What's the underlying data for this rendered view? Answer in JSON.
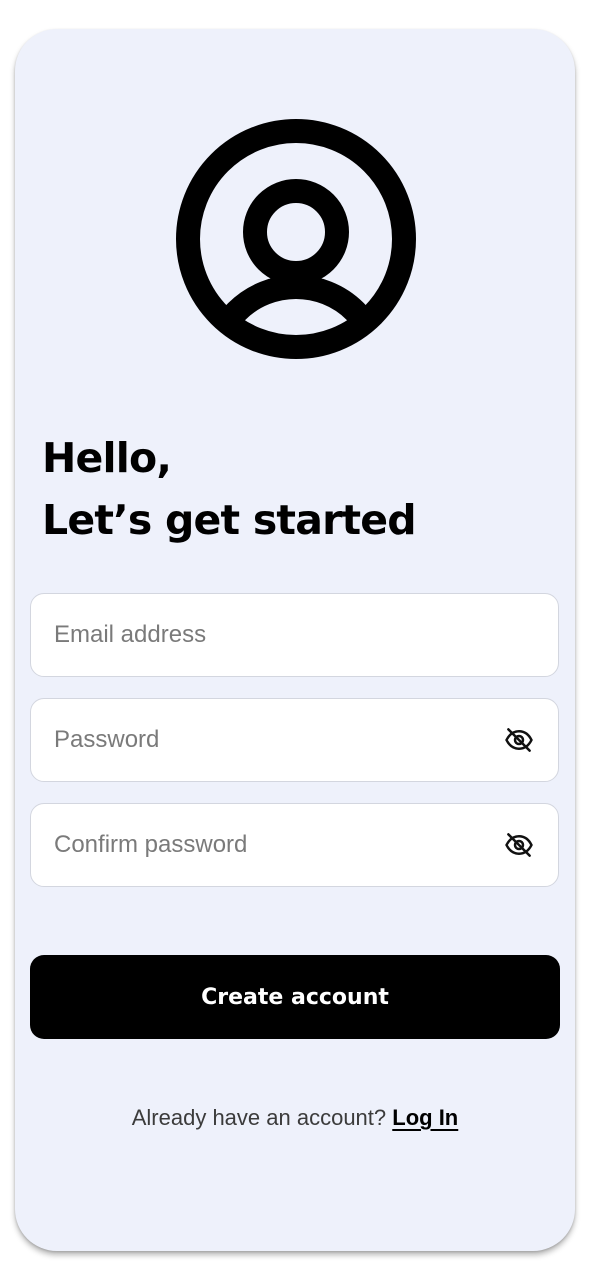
{
  "header": {
    "avatar_icon": "user-circle-icon",
    "greeting_line1": "Hello,",
    "greeting_line2": "Let’s get started"
  },
  "form": {
    "email": {
      "placeholder": "Email address",
      "value": ""
    },
    "password": {
      "placeholder": "Password",
      "value": "",
      "toggle_icon": "eye-off-icon"
    },
    "confirm_password": {
      "placeholder": "Confirm password",
      "value": "",
      "toggle_icon": "eye-off-icon"
    },
    "submit_label": "Create account"
  },
  "footer": {
    "prompt": "Already have an account?",
    "login_label": "Log In"
  },
  "colors": {
    "card_background": "#eef1fb",
    "primary_button": "#000000",
    "field_border": "#d3d6df"
  }
}
